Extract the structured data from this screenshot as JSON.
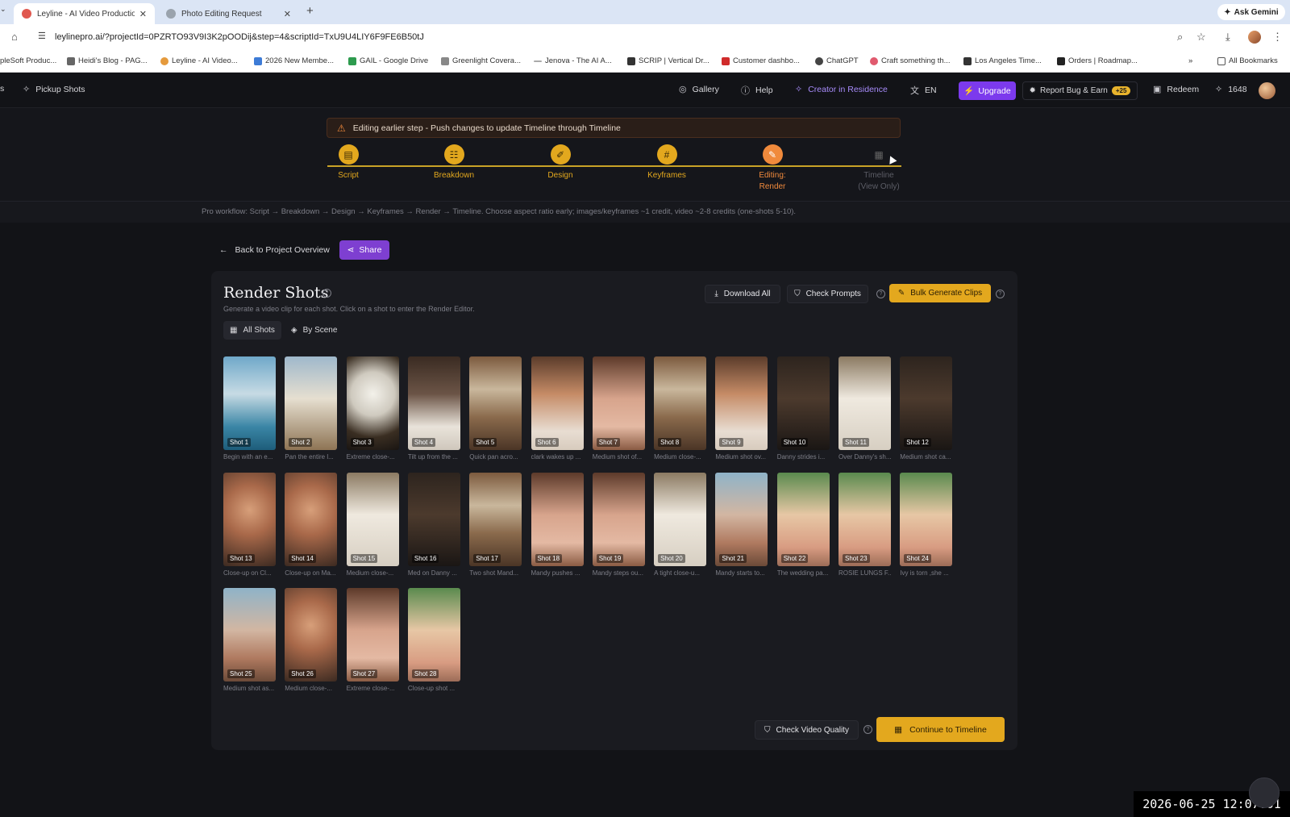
{
  "browser": {
    "tabs": [
      {
        "label": "Leyline - AI Video Production",
        "active": true,
        "favicon_color": "#e0584f"
      },
      {
        "label": "Photo Editing Request",
        "active": false,
        "favicon_color": "#666666"
      }
    ],
    "ask_gemini": "Ask Gemini",
    "url": "leylinepro.ai/?projectId=0PZRTO93V9I3K2pOODij&step=4&scriptId=TxU9U4LIY6F9FE6B50tJ",
    "bookmarks": [
      {
        "label": "pleSoft Produc...",
        "color": "#555555"
      },
      {
        "label": "Heidi's Blog - PAG...",
        "color": "#555555"
      },
      {
        "label": "Leyline - AI Video...",
        "color": "#e59a3c"
      },
      {
        "label": "2026 New Membe...",
        "color": "#3d7bd6"
      },
      {
        "label": "GAIL - Google Drive",
        "color": "#2d9b4e"
      },
      {
        "label": "Greenlight Covera...",
        "color": "#555555"
      },
      {
        "label": "Jenova - The AI A...",
        "color": "#555555"
      },
      {
        "label": "SCRIP | Vertical Dr...",
        "color": "#333333"
      },
      {
        "label": "Customer dashbo...",
        "color": "#d02b2b"
      },
      {
        "label": "ChatGPT",
        "color": "#444444"
      },
      {
        "label": "Craft something th...",
        "color": "#e05a6e"
      },
      {
        "label": "Los Angeles Time...",
        "color": "#333333"
      },
      {
        "label": "Orders | Roadmap...",
        "color": "#222222"
      }
    ],
    "all_bookmarks": "All Bookmarks"
  },
  "nav": {
    "left_partial": "s",
    "pickup_shots": "Pickup Shots",
    "gallery": "Gallery",
    "help": "Help",
    "creator": "Creator in Residence",
    "language": "EN",
    "upgrade": "Upgrade",
    "report_bug": "Report Bug & Earn",
    "report_badge": "+25",
    "redeem": "Redeem",
    "credits": "1648"
  },
  "warning": "Editing earlier step - Push changes to update Timeline through Timeline",
  "steps": [
    {
      "label": "Script",
      "state": "done"
    },
    {
      "label": "Breakdown",
      "state": "done"
    },
    {
      "label": "Design",
      "state": "done"
    },
    {
      "label": "Keyframes",
      "state": "done"
    },
    {
      "label": "Editing:",
      "label2": "Render",
      "state": "current"
    },
    {
      "label": "Timeline",
      "label2": "(View Only)",
      "state": "disabled"
    }
  ],
  "workflow": "Pro workflow: Script → Breakdown → Design → Keyframes → Render → Timeline. Choose aspect ratio early; images/keyframes ~1 credit, video ~2-8 credits (one-shots 5-10).",
  "back": "Back to Project Overview",
  "share": "Share",
  "panel": {
    "title": "Render Shots",
    "subtitle": "Generate a video clip for each shot. Click on a shot to enter the Render Editor.",
    "download_all": "Download All",
    "check_prompts": "Check Prompts",
    "bulk_generate": "Bulk Generate Clips",
    "view_all": "All Shots",
    "view_scene": "By Scene",
    "check_video_quality": "Check Video Quality",
    "continue": "Continue to Timeline"
  },
  "shots": [
    {
      "label": "Shot 1",
      "desc": "Begin with an e...",
      "style": "t-sea"
    },
    {
      "label": "Shot 2",
      "desc": "Pan the entire l...",
      "style": "t-sail"
    },
    {
      "label": "Shot 3",
      "desc": "Extreme close-...",
      "style": "t-hat"
    },
    {
      "label": "Shot 4",
      "desc": "Tilt up from the ...",
      "style": "t-bed"
    },
    {
      "label": "Shot 5",
      "desc": "Quick pan acro...",
      "style": "t-cabin"
    },
    {
      "label": "Shot 6",
      "desc": "clark wakes up ...",
      "style": "t-skin"
    },
    {
      "label": "Shot 7",
      "desc": "Medium shot of...",
      "style": "t-pink"
    },
    {
      "label": "Shot 8",
      "desc": "Medium close-...",
      "style": "t-cabin"
    },
    {
      "label": "Shot 9",
      "desc": "Medium shot ov...",
      "style": "t-skin"
    },
    {
      "label": "Shot 10",
      "desc": "Danny strides i...",
      "style": "t-dark"
    },
    {
      "label": "Shot 11",
      "desc": "Over Danny's sh...",
      "style": "t-white"
    },
    {
      "label": "Shot 12",
      "desc": "Medium shot ca...",
      "style": "t-dark"
    },
    {
      "label": "Shot 13",
      "desc": "Close-up on Cl...",
      "style": "t-face"
    },
    {
      "label": "Shot 14",
      "desc": "Close-up on Ma...",
      "style": "t-face"
    },
    {
      "label": "Shot 15",
      "desc": "Medium close-...",
      "style": "t-white"
    },
    {
      "label": "Shot 16",
      "desc": "Med on Danny ...",
      "style": "t-dark"
    },
    {
      "label": "Shot 17",
      "desc": "Two shot Mand...",
      "style": "t-cabin"
    },
    {
      "label": "Shot 18",
      "desc": "Mandy pushes ...",
      "style": "t-pink"
    },
    {
      "label": "Shot 19",
      "desc": "Mandy steps ou...",
      "style": "t-pink"
    },
    {
      "label": "Shot 20",
      "desc": "A tight close-u...",
      "style": "t-white"
    },
    {
      "label": "Shot 21",
      "desc": "Mandy starts to...",
      "style": "t-deck"
    },
    {
      "label": "Shot 22",
      "desc": "The wedding pa...",
      "style": "t-bright"
    },
    {
      "label": "Shot 23",
      "desc": "ROSIE LUNGS F...",
      "style": "t-bright"
    },
    {
      "label": "Shot 24",
      "desc": "Ivy is torn ,she ...",
      "style": "t-bright"
    },
    {
      "label": "Shot 25",
      "desc": "Medium shot as...",
      "style": "t-deck"
    },
    {
      "label": "Shot 26",
      "desc": "Medium close-...",
      "style": "t-face"
    },
    {
      "label": "Shot 27",
      "desc": "Extreme close-...",
      "style": "t-pink"
    },
    {
      "label": "Shot 28",
      "desc": "Close-up shot ...",
      "style": "t-bright"
    }
  ],
  "timestamp": "2026-06-25  12:07:01"
}
